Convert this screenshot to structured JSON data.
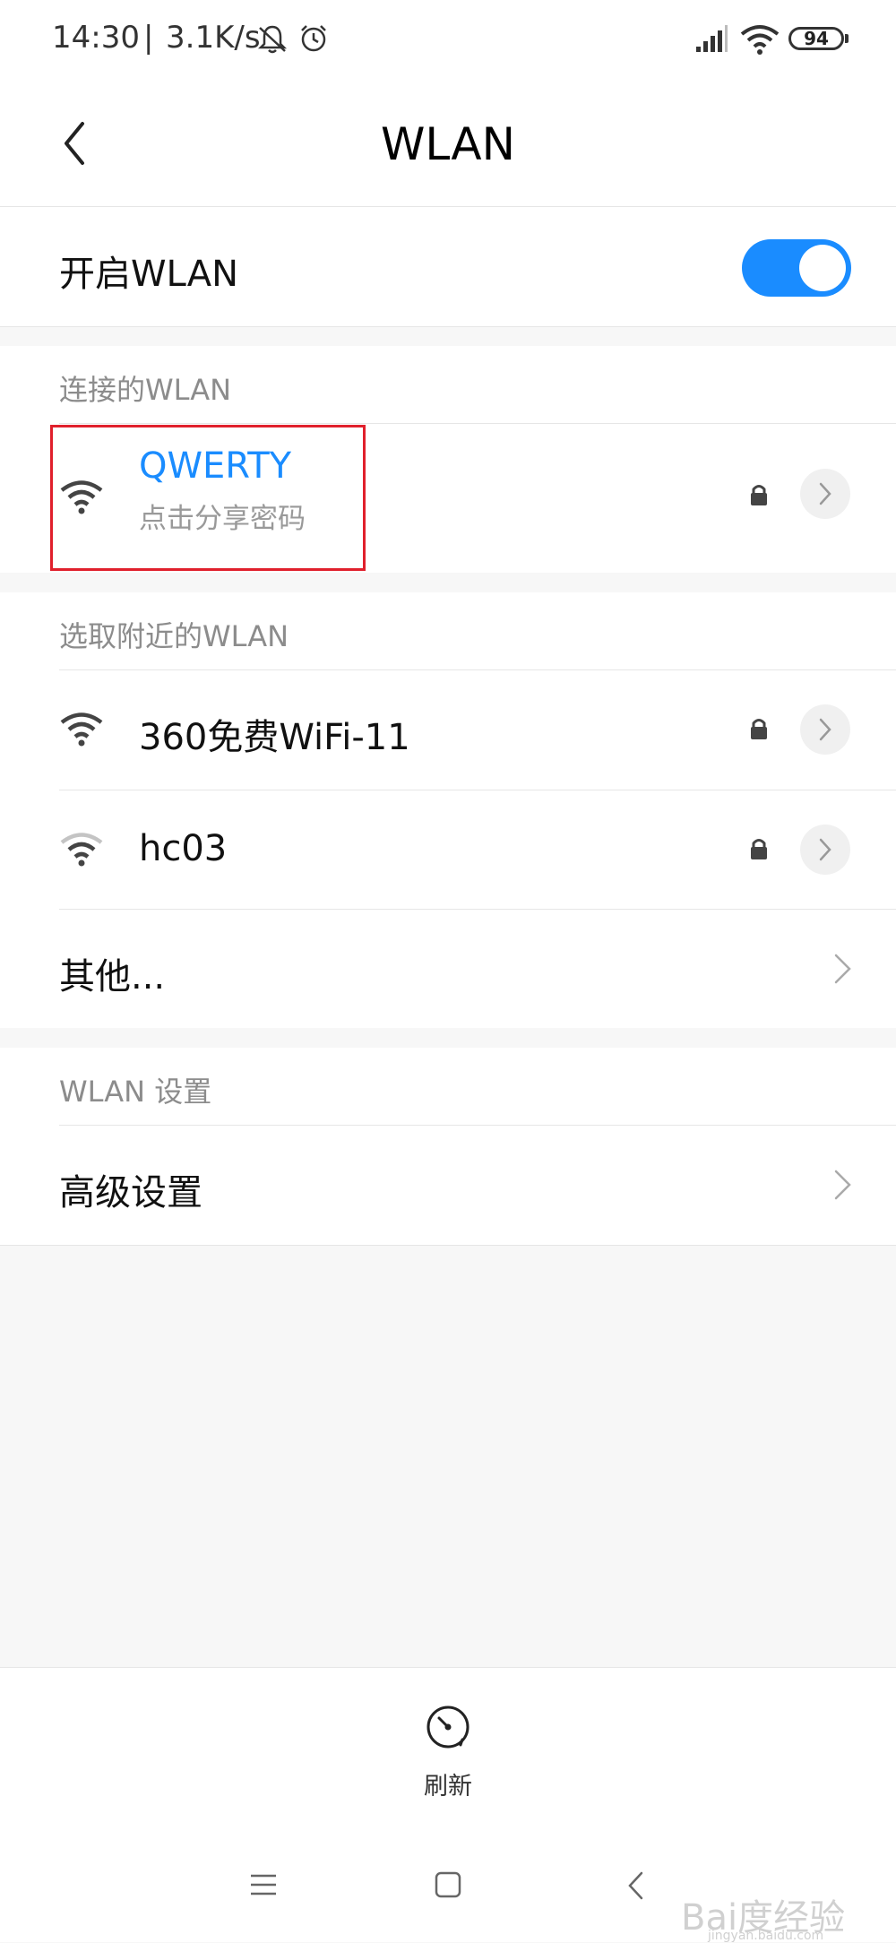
{
  "status_bar": {
    "time": "14:30",
    "separator": "|",
    "speed": "3.1K/s",
    "icons": [
      "bell-muted-icon",
      "alarm-icon",
      "signal-icon",
      "wifi-icon"
    ],
    "battery": "94"
  },
  "header": {
    "title": "WLAN",
    "back_icon": "chevron-left-icon"
  },
  "wlan_toggle": {
    "label": "开启WLAN",
    "enabled": true,
    "accent_color": "#1a8cff"
  },
  "connected_section": {
    "header": "连接的WLAN",
    "network": {
      "name": "QWERTY",
      "subtitle": "点击分享密码",
      "locked": true
    }
  },
  "nearby_section": {
    "header": "选取附近的WLAN",
    "networks": [
      {
        "name": "360免费WiFi-11",
        "locked": true,
        "signal": "full"
      },
      {
        "name": "hc03",
        "locked": true,
        "signal": "medium"
      }
    ],
    "other_label": "其他..."
  },
  "settings_section": {
    "header": "WLAN 设置",
    "advanced_label": "高级设置"
  },
  "bottom_action": {
    "refresh_label": "刷新"
  },
  "nav_bar": {
    "icons": [
      "menu-icon",
      "home-icon",
      "back-icon"
    ]
  },
  "watermark": {
    "text": "Bai度经验",
    "sub": "jingyan.baidu.com"
  }
}
